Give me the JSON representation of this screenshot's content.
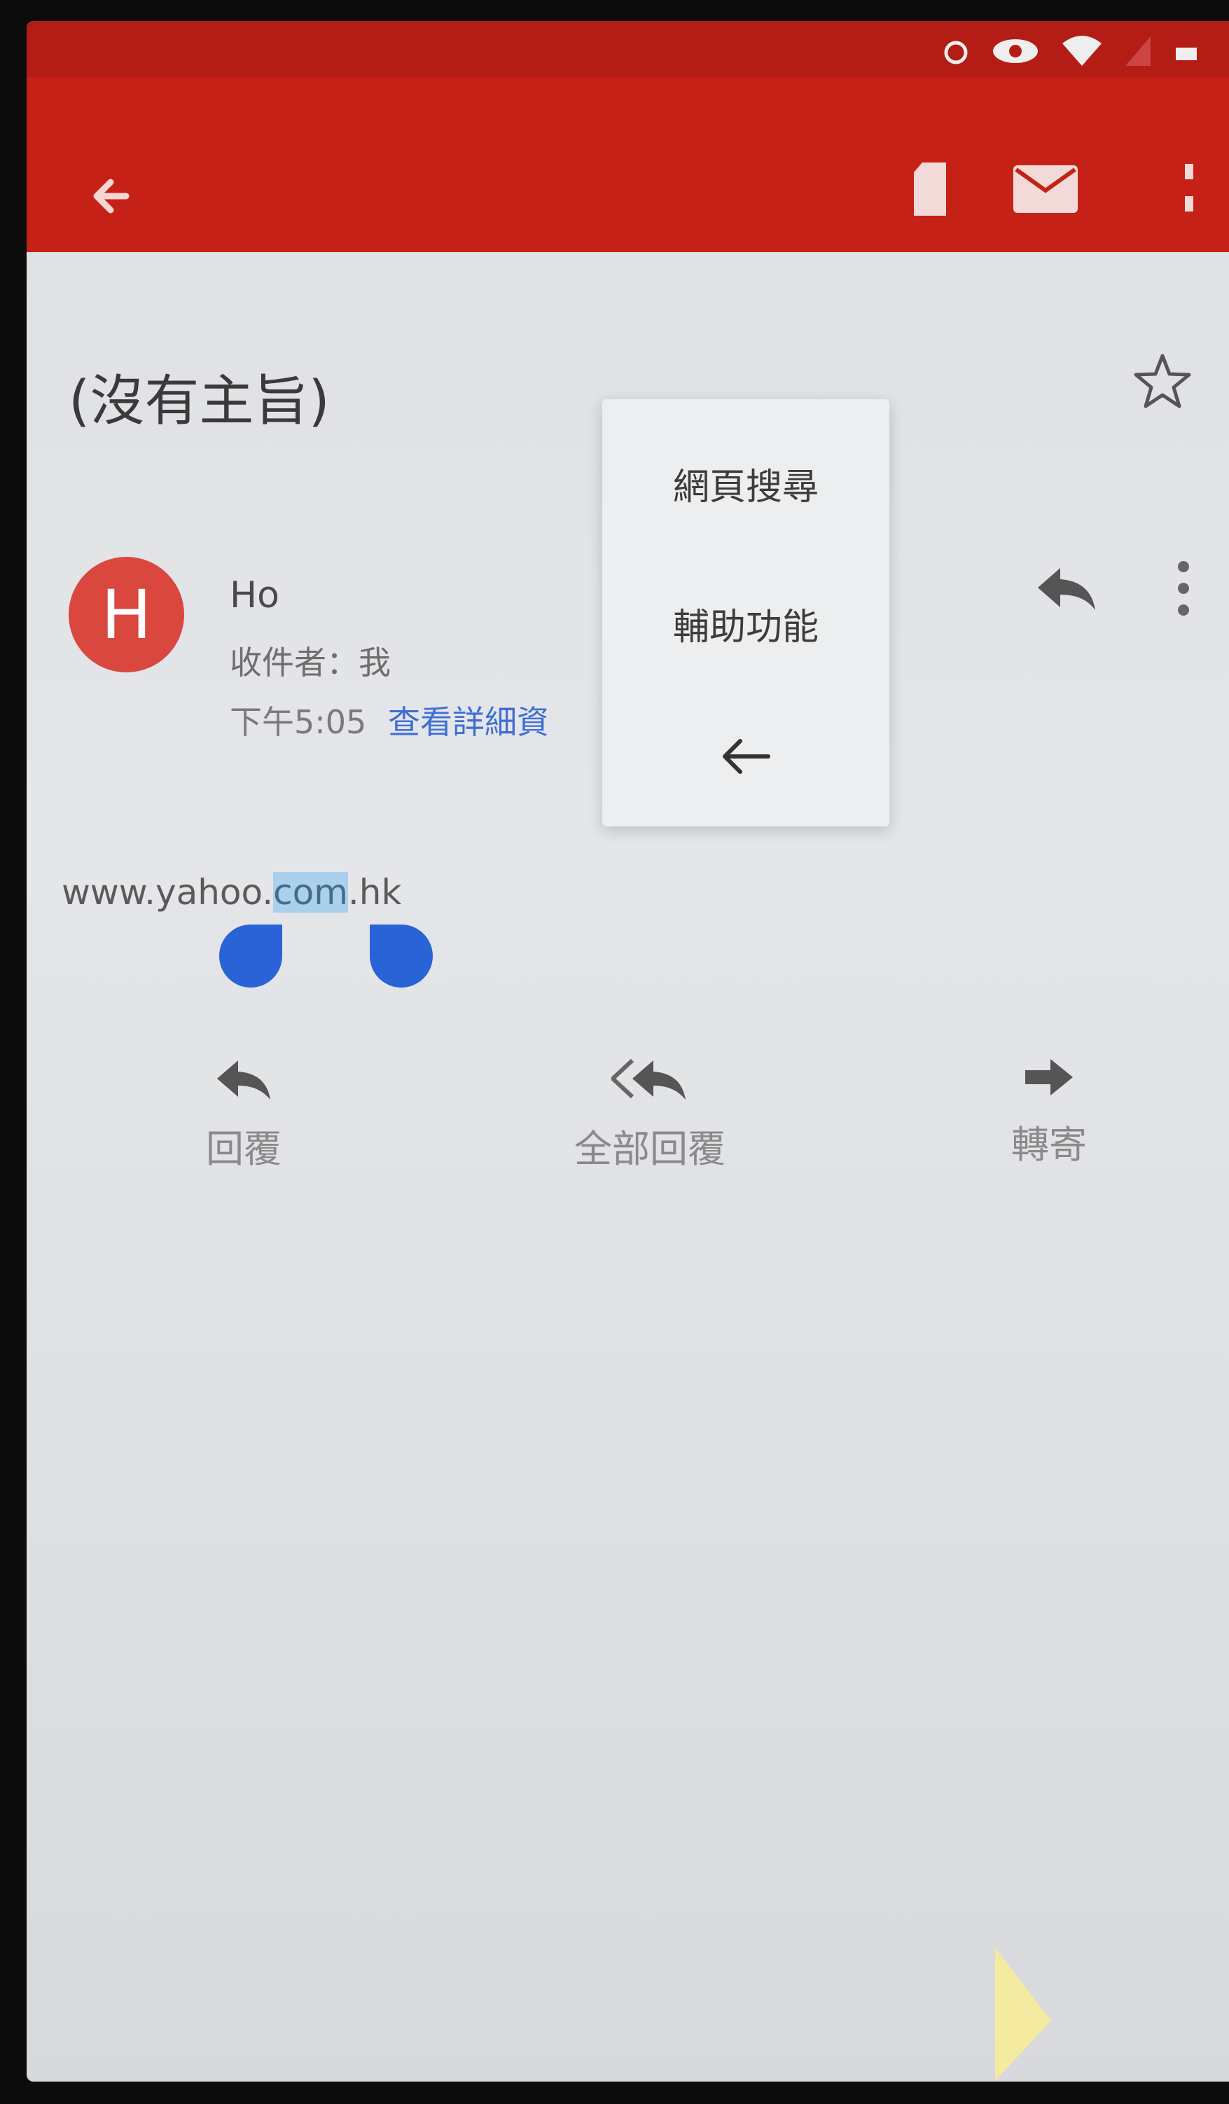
{
  "colors": {
    "app_bar": "#c62117",
    "status_bar": "#b41d15",
    "avatar": "#d9473f",
    "link": "#3f6fd3",
    "selection": "#a9d0ec",
    "handle": "#2a63d6"
  },
  "toolbar": {
    "back_icon": "arrow-left-icon",
    "archive_icon": "archive-icon",
    "mail_icon": "mark-unread-icon",
    "more_icon": "more-vertical-icon"
  },
  "email": {
    "subject": "(沒有主旨)",
    "sender_name": "Ho",
    "avatar_letter": "H",
    "recipient": "收件者：我",
    "time": "下午5:05",
    "details_link": "查看詳細資",
    "body_before": "www.yahoo.",
    "body_selected": "com",
    "body_after": ".hk"
  },
  "context_menu": {
    "items": [
      {
        "label": "網頁搜尋"
      },
      {
        "label": "輔助功能"
      }
    ],
    "back_icon": "arrow-left-icon"
  },
  "actions": {
    "reply": "回覆",
    "reply_all": "全部回覆",
    "forward": "轉寄"
  }
}
